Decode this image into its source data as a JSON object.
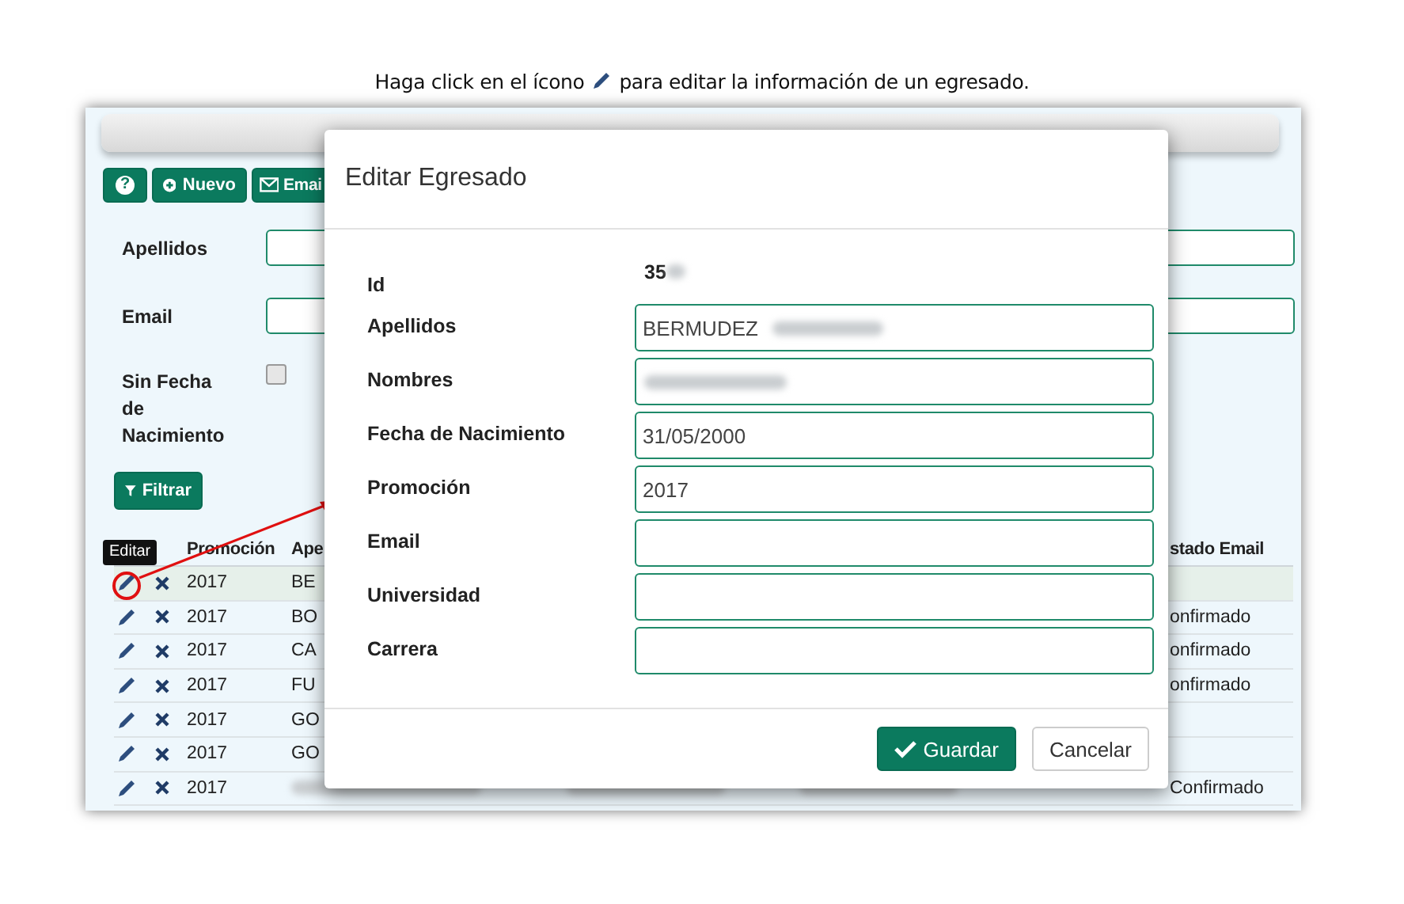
{
  "caption": {
    "before": "Haga click en el ícono",
    "after": "para editar la información de un egresado."
  },
  "toolbar": [
    {
      "kind": "help",
      "label": "?"
    },
    {
      "kind": "new",
      "label": "Nuevo"
    },
    {
      "kind": "email",
      "label": "Emai"
    }
  ],
  "filters": [
    {
      "kind": "text",
      "label": "Apellidos"
    },
    {
      "kind": "text",
      "label": "Email"
    },
    {
      "kind": "checkbox",
      "label": "Sin Fecha de Nacimiento",
      "checked": false
    }
  ],
  "filter_button": "Filtrar",
  "table": {
    "columns": [
      "Promoción",
      "Ape",
      "stado Email"
    ],
    "rows": [
      {
        "promocion": "2017",
        "apellidos": "BE",
        "selected": true
      },
      {
        "promocion": "2017",
        "apellidos": "BO",
        "estado": "onfirmado",
        "selected": false
      },
      {
        "promocion": "2017",
        "apellidos": "CA",
        "estado": "onfirmado",
        "selected": false
      },
      {
        "promocion": "2017",
        "apellidos": "FU",
        "estado": "onfirmado",
        "selected": false
      },
      {
        "promocion": "2017",
        "apellidos": "GO",
        "selected": false
      },
      {
        "promocion": "2017",
        "apellidos": "GO",
        "selected": false
      },
      {
        "promocion": "2017",
        "redacted": true,
        "estado": "Confirmado",
        "selected": false
      }
    ]
  },
  "tooltip": "Editar",
  "modal": {
    "title": "Editar Egresado",
    "id_label": "Id",
    "id_value": "35",
    "id_redacted": true,
    "fields": [
      {
        "label": "Apellidos",
        "value": "BERMUDEZ",
        "redacted": true
      },
      {
        "label": "Nombres",
        "redacted": true
      },
      {
        "label": "Fecha de Nacimiento",
        "value": "31/05/2000",
        "redacted": false
      },
      {
        "label": "Promoción",
        "value": "2017",
        "redacted": false
      },
      {
        "label": "Email",
        "redacted": false
      },
      {
        "label": "Universidad",
        "redacted": false
      },
      {
        "label": "Carrera",
        "redacted": false
      }
    ],
    "buttons": [
      {
        "kind": "primary",
        "label": "Guardar"
      },
      {
        "kind": "default",
        "label": "Cancelar"
      }
    ]
  }
}
